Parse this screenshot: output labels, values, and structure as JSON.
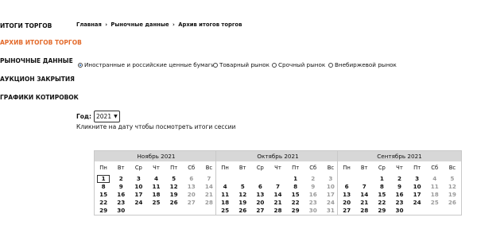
{
  "sidebar": {
    "items": [
      {
        "label": "ИТОГИ ТОРГОВ",
        "active": false
      },
      {
        "label": "АРХИВ ИТОГОВ ТОРГОВ",
        "active": true
      },
      {
        "label": "РЫНОЧНЫЕ ДАННЫЕ",
        "active": false
      },
      {
        "label": "АУКЦИОН ЗАКРЫТИЯ",
        "active": false
      },
      {
        "label": "ГРАФИКИ КОТИРОВОК",
        "active": false
      }
    ]
  },
  "breadcrumb": {
    "items": [
      "Главная",
      "Рыночные данные",
      "Архив итогов торгов"
    ],
    "separator": "›"
  },
  "markets": {
    "options": [
      {
        "label": "Иностранные и российские ценные бумаги",
        "selected": true
      },
      {
        "label": "Товарный рынок",
        "selected": false
      },
      {
        "label": "Срочный рынок",
        "selected": false
      },
      {
        "label": "Внебиржевой рынок",
        "selected": false
      }
    ]
  },
  "year": {
    "label": "Год:",
    "value": "2021"
  },
  "hint": "Кликните на дату чтобы посмотреть итоги сессии",
  "weekdays": [
    "Пн",
    "Вт",
    "Ср",
    "Чт",
    "Пт",
    "Сб",
    "Вс"
  ],
  "calendars": [
    {
      "title": "Ноябрь 2021",
      "first_weekday": 1,
      "days": 30,
      "selected_day": 1
    },
    {
      "title": "Октябрь 2021",
      "first_weekday": 5,
      "days": 31,
      "selected_day": null
    },
    {
      "title": "Сентябрь 2021",
      "first_weekday": 3,
      "days": 30,
      "selected_day": null
    }
  ],
  "colors": {
    "accent": "#e36a2b",
    "header_bg": "#d7d7d7",
    "weekend": "#9a9a9a"
  }
}
